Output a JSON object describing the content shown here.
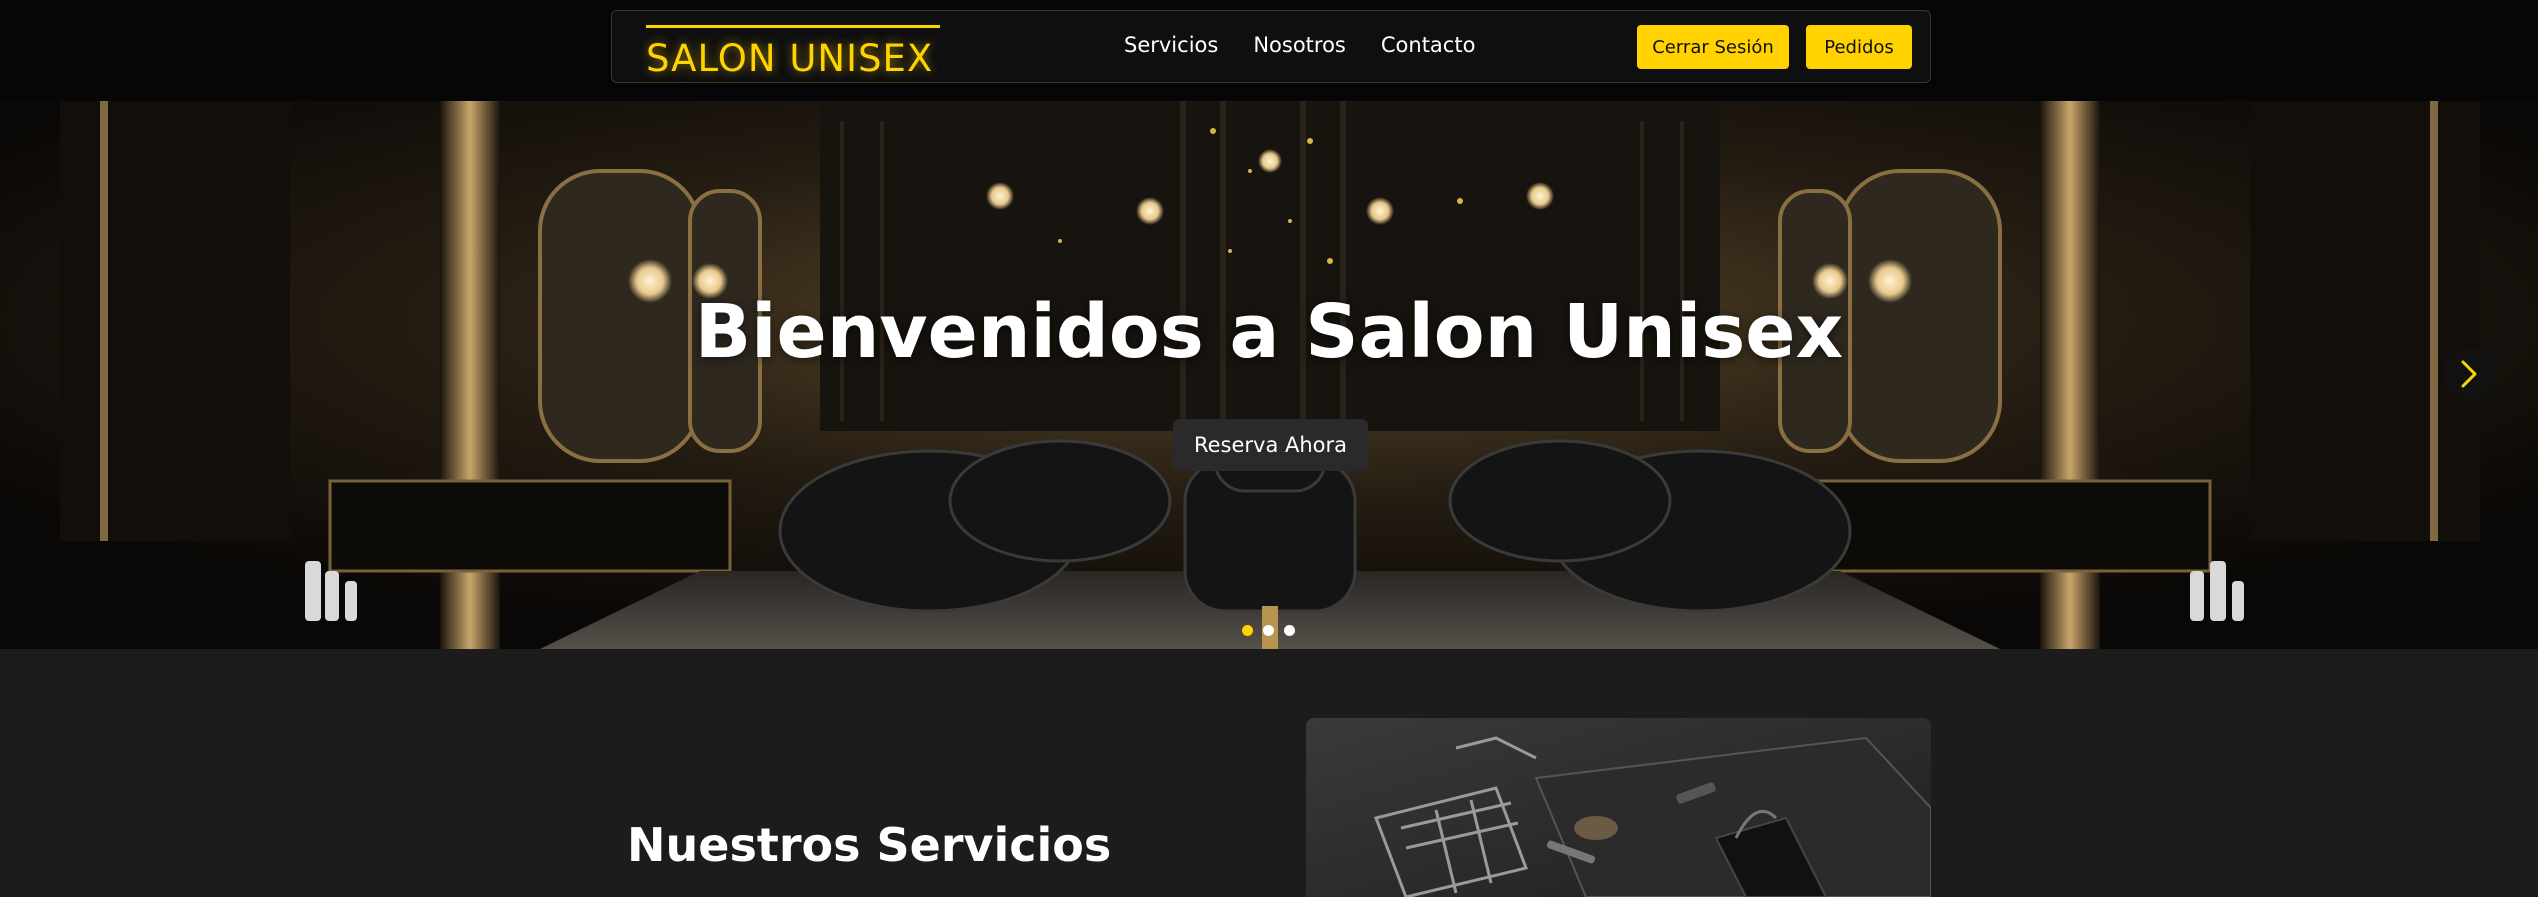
{
  "header": {
    "brand": "SALON UNISEX",
    "nav": [
      "Servicios",
      "Nosotros",
      "Contacto"
    ],
    "logout_label": "Cerrar Sesión",
    "orders_label": "Pedidos"
  },
  "hero": {
    "title": "Bienvenidos a Salon Unisex",
    "cta_label": "Reserva Ahora",
    "carousel": {
      "total_slides": 3,
      "active_slide": 1
    }
  },
  "services": {
    "title": "Nuestros Servicios"
  },
  "icons": {
    "next": "chevron-right-icon"
  },
  "colors": {
    "accent": "#ffd200",
    "background": "#1c1c1c",
    "header_bg": "#060606",
    "button_dark": "#2a2a2a"
  }
}
